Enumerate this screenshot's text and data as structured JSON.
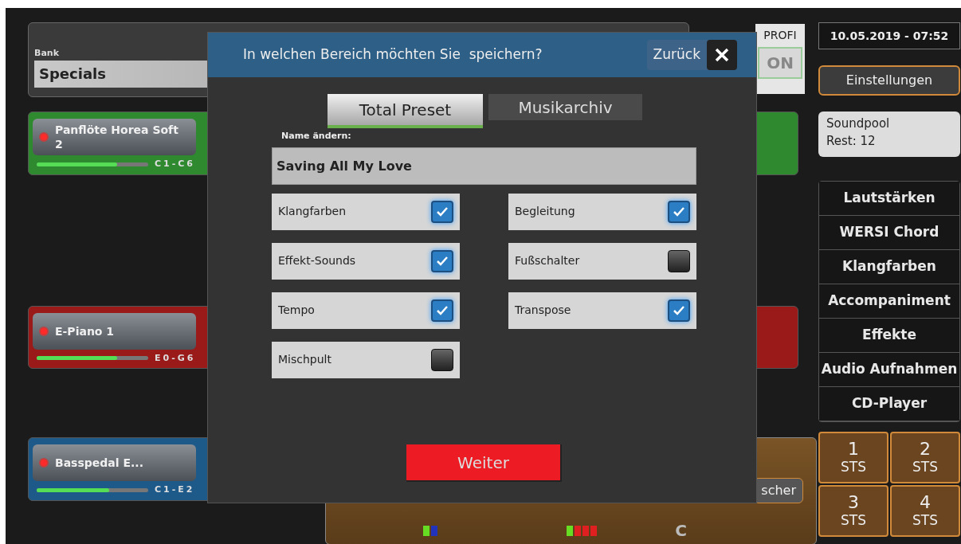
{
  "bank": {
    "label": "Bank",
    "value": "Specials"
  },
  "profi": {
    "label": "PROFI",
    "button": "ON"
  },
  "datetime": "10.05.2019 - 07:52",
  "settings_button": "Einstellungen",
  "soundpool": {
    "line1": "Soundpool",
    "line2": "Rest: 12"
  },
  "menu": [
    "Lautstärken",
    "WERSI Chord",
    "Klangfarben",
    "Accompaniment",
    "Effekte",
    "Audio Aufnahmen",
    "CD-Player"
  ],
  "manuals": [
    {
      "name": "Panflöte Horea Soft 2",
      "range": "C1-C6",
      "level": 0.72,
      "color": "#2f8a2f"
    },
    {
      "name": "E-Piano 1",
      "range": "E0-G6",
      "level": 0.72,
      "color": "#9a1a1a"
    },
    {
      "name": "Basspedal E...",
      "range": "C1-E2",
      "level": 0.65,
      "color": "#1d5a8a"
    }
  ],
  "style_panel": {
    "button": "scher",
    "harmony": "C",
    "indicators": [
      {
        "segments": [
          {
            "color": "#66dd22"
          },
          {
            "color": "#2233bb"
          }
        ]
      },
      {
        "segments": [
          {
            "color": "#66dd22"
          },
          {
            "color": "#e02020"
          },
          {
            "color": "#e02020"
          },
          {
            "color": "#e02020"
          }
        ]
      }
    ]
  },
  "sts": [
    {
      "number": "1",
      "label": "STS"
    },
    {
      "number": "2",
      "label": "STS"
    },
    {
      "number": "3",
      "label": "STS"
    },
    {
      "number": "4",
      "label": "STS"
    }
  ],
  "dialog": {
    "title": "In welchen Bereich möchten Sie  speichern?",
    "back": "Zurück",
    "tabs": [
      {
        "label": "Total Preset",
        "selected": true
      },
      {
        "label": "Musikarchiv",
        "selected": false
      }
    ],
    "name_label": "Name ändern:",
    "name_value": "Saving All My Love",
    "options": [
      {
        "label": "Klangfarben",
        "checked": true
      },
      {
        "label": "Begleitung",
        "checked": true
      },
      {
        "label": "Effekt-Sounds",
        "checked": true
      },
      {
        "label": "Fußschalter",
        "checked": false
      },
      {
        "label": "Tempo",
        "checked": true
      },
      {
        "label": "Transpose",
        "checked": true
      },
      {
        "label": "Mischpult",
        "checked": false
      }
    ],
    "confirm": "Weiter"
  }
}
